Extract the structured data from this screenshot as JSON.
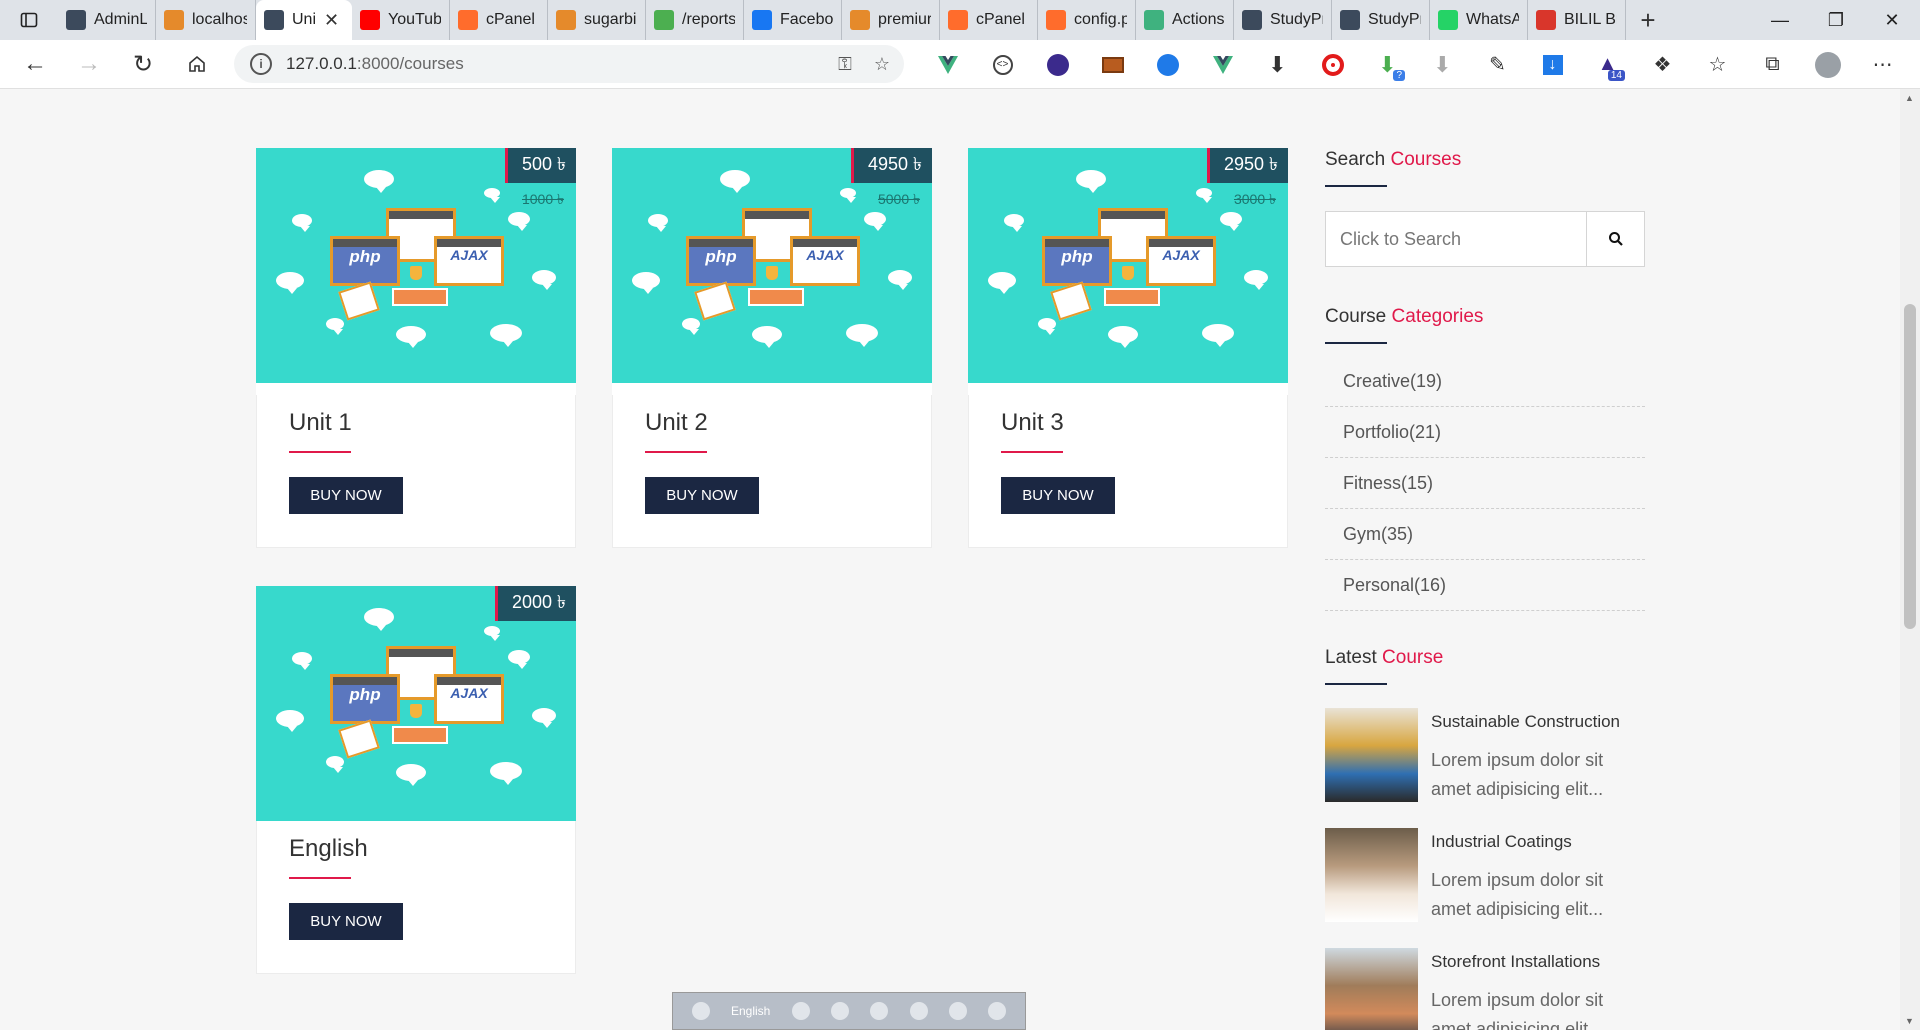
{
  "browser": {
    "tabs": [
      {
        "title": "AdminLT",
        "fav": "book-icon",
        "color": "#3c4a5c"
      },
      {
        "title": "localhos",
        "fav": "pma-icon",
        "color": "#e58a2b"
      },
      {
        "title": "Uni",
        "fav": "book-icon",
        "color": "#3c4a5c",
        "active": true
      },
      {
        "title": "YouTub",
        "fav": "youtube-icon",
        "color": "#ff0000"
      },
      {
        "title": "cPanel -",
        "fav": "cpanel-icon",
        "color": "#ff6c2c"
      },
      {
        "title": "sugarbi",
        "fav": "pma-icon",
        "color": "#e58a2b"
      },
      {
        "title": "/reports",
        "fav": "chrome-icon",
        "color": "#4caf50"
      },
      {
        "title": "Faceboo",
        "fav": "facebook-icon",
        "color": "#1877f2"
      },
      {
        "title": "premiur",
        "fav": "pma-icon",
        "color": "#e58a2b"
      },
      {
        "title": "cPanel F",
        "fav": "cpanel-icon",
        "color": "#ff6c2c"
      },
      {
        "title": "config.p",
        "fav": "cpanel-icon",
        "color": "#ff6c2c"
      },
      {
        "title": "Actions",
        "fav": "vue-icon",
        "color": "#3fb27f"
      },
      {
        "title": "StudyPr",
        "fav": "book-icon",
        "color": "#3c4a5c"
      },
      {
        "title": "StudyPr",
        "fav": "book-icon",
        "color": "#3c4a5c"
      },
      {
        "title": "WhatsA",
        "fav": "whatsapp-icon",
        "color": "#25d366"
      },
      {
        "title": "BILIL Br",
        "fav": "pdf-icon",
        "color": "#d9362b"
      }
    ],
    "url_host": "127.0.0.1",
    "url_path": ":8000/courses",
    "extension_badge": "14"
  },
  "courses": [
    {
      "title": "Unit 1",
      "price": "500 ৳",
      "old_price": "1000 ৳",
      "button": "BUY NOW"
    },
    {
      "title": "Unit 2",
      "price": "4950 ৳",
      "old_price": "5000 ৳",
      "button": "BUY NOW"
    },
    {
      "title": "Unit 3",
      "price": "2950 ৳",
      "old_price": "3000 ৳",
      "button": "BUY NOW"
    },
    {
      "title": "English",
      "price": "2000 ৳",
      "old_price": "",
      "button": "BUY NOW"
    }
  ],
  "illustration_labels": {
    "php": "php",
    "ajax": "AJAX"
  },
  "sidebar": {
    "search_heading": {
      "plain": "Search ",
      "accent": "Courses"
    },
    "search_placeholder": "Click to Search",
    "categories_heading": {
      "plain": "Course ",
      "accent": "Categories"
    },
    "categories": [
      "Creative(19)",
      "Portfolio(21)",
      "Fitness(15)",
      "Gym(35)",
      "Personal(16)"
    ],
    "latest_heading": {
      "plain": "Latest ",
      "accent": "Course"
    },
    "latest": [
      {
        "title": "Sustainable Construction",
        "desc": "Lorem ipsum dolor sit amet adipisicing elit..."
      },
      {
        "title": "Industrial Coatings",
        "desc": "Lorem ipsum dolor sit amet adipisicing elit..."
      },
      {
        "title": "Storefront Installations",
        "desc": "Lorem ipsum dolor sit amet adipisicing elit..."
      }
    ]
  },
  "langbar": {
    "language": "English"
  },
  "colors": {
    "accent": "#e0194a",
    "navy": "#1b2742",
    "teal": "#37d9cc",
    "price_bg": "#1f5060"
  }
}
